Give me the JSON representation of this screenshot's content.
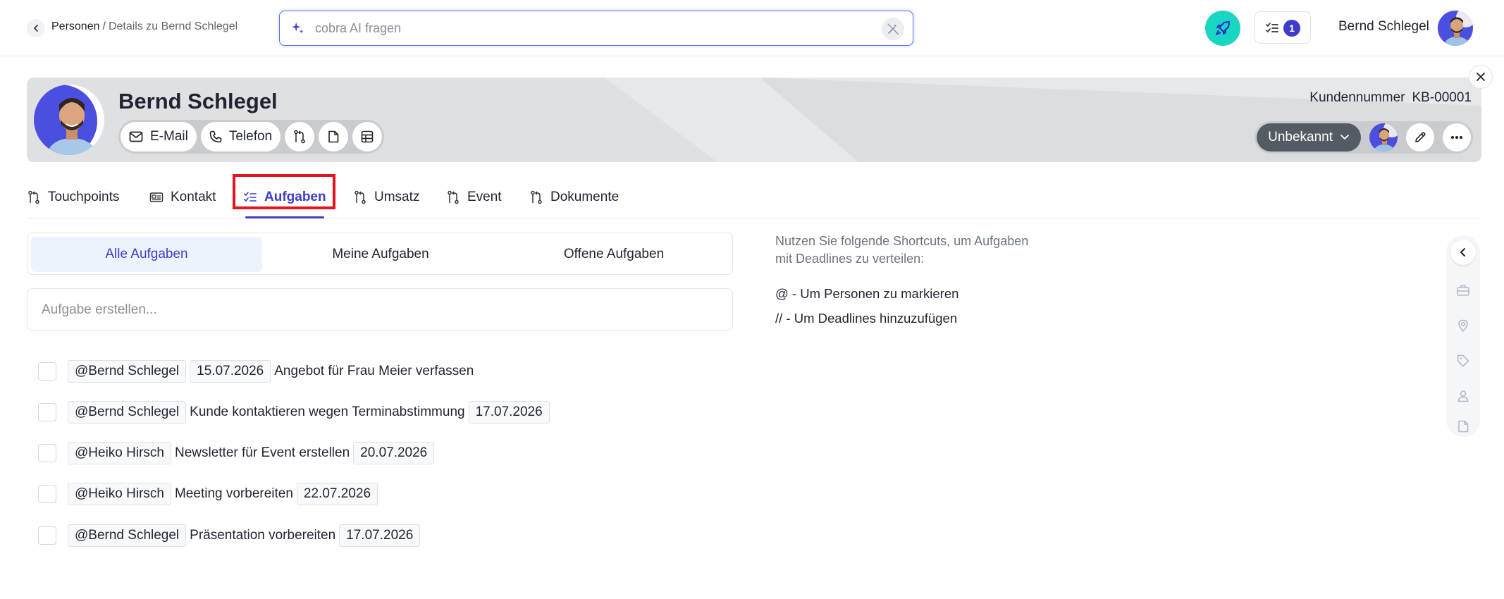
{
  "breadcrumb": {
    "root": "Personen",
    "separator": "/",
    "current": "Details zu Bernd Schlegel"
  },
  "ai_search": {
    "placeholder": "cobra AI fragen"
  },
  "notifications": {
    "task_count": "1"
  },
  "user": {
    "name": "Bernd Schlegel"
  },
  "profile": {
    "name": "Bernd Schlegel",
    "customer_number_label": "Kundennummer",
    "customer_number": "KB-00001",
    "email_label": "E-Mail",
    "phone_label": "Telefon",
    "status": "Unbekannt"
  },
  "tabs": [
    {
      "label": "Touchpoints",
      "icon": "pull-request-icon"
    },
    {
      "label": "Kontakt",
      "icon": "id-card-icon"
    },
    {
      "label": "Aufgaben",
      "icon": "task-list-icon",
      "active": true
    },
    {
      "label": "Umsatz",
      "icon": "pull-request-icon"
    },
    {
      "label": "Event",
      "icon": "pull-request-icon"
    },
    {
      "label": "Dokumente",
      "icon": "pull-request-icon"
    }
  ],
  "filters": [
    "Alle Aufgaben",
    "Meine Aufgaben",
    "Offene Aufgaben"
  ],
  "task_input": {
    "placeholder": "Aufgabe erstellen..."
  },
  "tasks": [
    {
      "mention": "@Bernd Schlegel",
      "date": "15.07.2026",
      "text": "Angebot für Frau Meier verfassen"
    },
    {
      "mention": "@Bernd Schlegel",
      "text": "Kunde kontaktieren wegen Terminabstimmung",
      "date": "17.07.2026"
    },
    {
      "mention": "@Heiko Hirsch",
      "text": "Newsletter für Event erstellen",
      "date": "20.07.2026"
    },
    {
      "mention": "@Heiko Hirsch",
      "text": "Meeting vorbereiten",
      "date": "22.07.2026"
    },
    {
      "mention": "@Bernd Schlegel",
      "text": "Präsentation vorbereiten",
      "date": "17.07.2026"
    }
  ],
  "shortcuts": {
    "hint_line1": "Nutzen Sie folgende Shortcuts, um Aufgaben",
    "hint_line2": "mit Deadlines zu verteilen:",
    "mention": "@ - Um Personen zu markieren",
    "deadline": "// - Um Deadlines hinzuzufügen"
  },
  "colors": {
    "accent": "#3f3ccb",
    "rocket": "#19d6c2",
    "highlight": "#e3141c"
  }
}
